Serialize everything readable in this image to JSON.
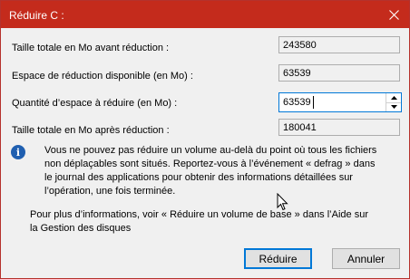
{
  "window": {
    "title": "Réduire C :",
    "close_icon": "close-icon",
    "accent_color": "#c42b1c"
  },
  "fields": {
    "total_before": {
      "label": "Taille totale en Mo avant réduction :",
      "value": "243580"
    },
    "available": {
      "label": "Espace de réduction disponible (en Mo) :",
      "value": "63539"
    },
    "amount": {
      "label": "Quantité d’espace à réduire (en Mo) :",
      "value": "63539"
    },
    "total_after": {
      "label": "Taille totale en Mo après réduction :",
      "value": "180041"
    }
  },
  "info": {
    "icon": "info-icon",
    "text": "Vous ne pouvez pas réduire un volume au-delà du point où tous les fichiers non déplaçables sont situés. Reportez-vous à l’événement « defrag » dans le journal des applications pour obtenir des informations détaillées sur l’opération, une fois terminée.",
    "more": "Pour plus d’informations, voir « Réduire un volume de base » dans l’Aide sur la Gestion des disques"
  },
  "buttons": {
    "shrink": "Réduire",
    "cancel": "Annuler"
  }
}
